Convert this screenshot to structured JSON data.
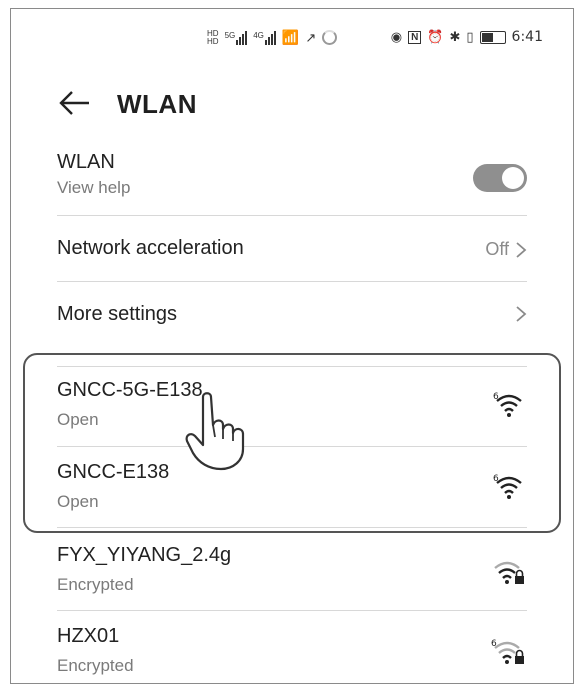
{
  "status_bar": {
    "time": "6:41",
    "net_5g": "5G",
    "net_4g": "4G"
  },
  "header": {
    "title": "WLAN"
  },
  "wlan_toggle": {
    "label": "WLAN",
    "help": "View help",
    "on": true
  },
  "network_acceleration": {
    "label": "Network acceleration",
    "value": "Off"
  },
  "more_settings": {
    "label": "More settings"
  },
  "networks": [
    {
      "ssid": "GNCC-5G-E138",
      "status": "Open"
    },
    {
      "ssid": "GNCC-E138",
      "status": "Open"
    },
    {
      "ssid": "FYX_YIYANG_2.4g",
      "status": "Encrypted"
    },
    {
      "ssid": "HZX01",
      "status": "Encrypted"
    }
  ],
  "colors": {
    "toggle_on": "#8f8f8f",
    "text": "#222222",
    "subtext": "#7a7a7a"
  },
  "icons": [
    "back-arrow-icon",
    "chevron-right-icon",
    "wifi-6-icon",
    "wifi-locked-icon",
    "pointing-hand-icon"
  ]
}
